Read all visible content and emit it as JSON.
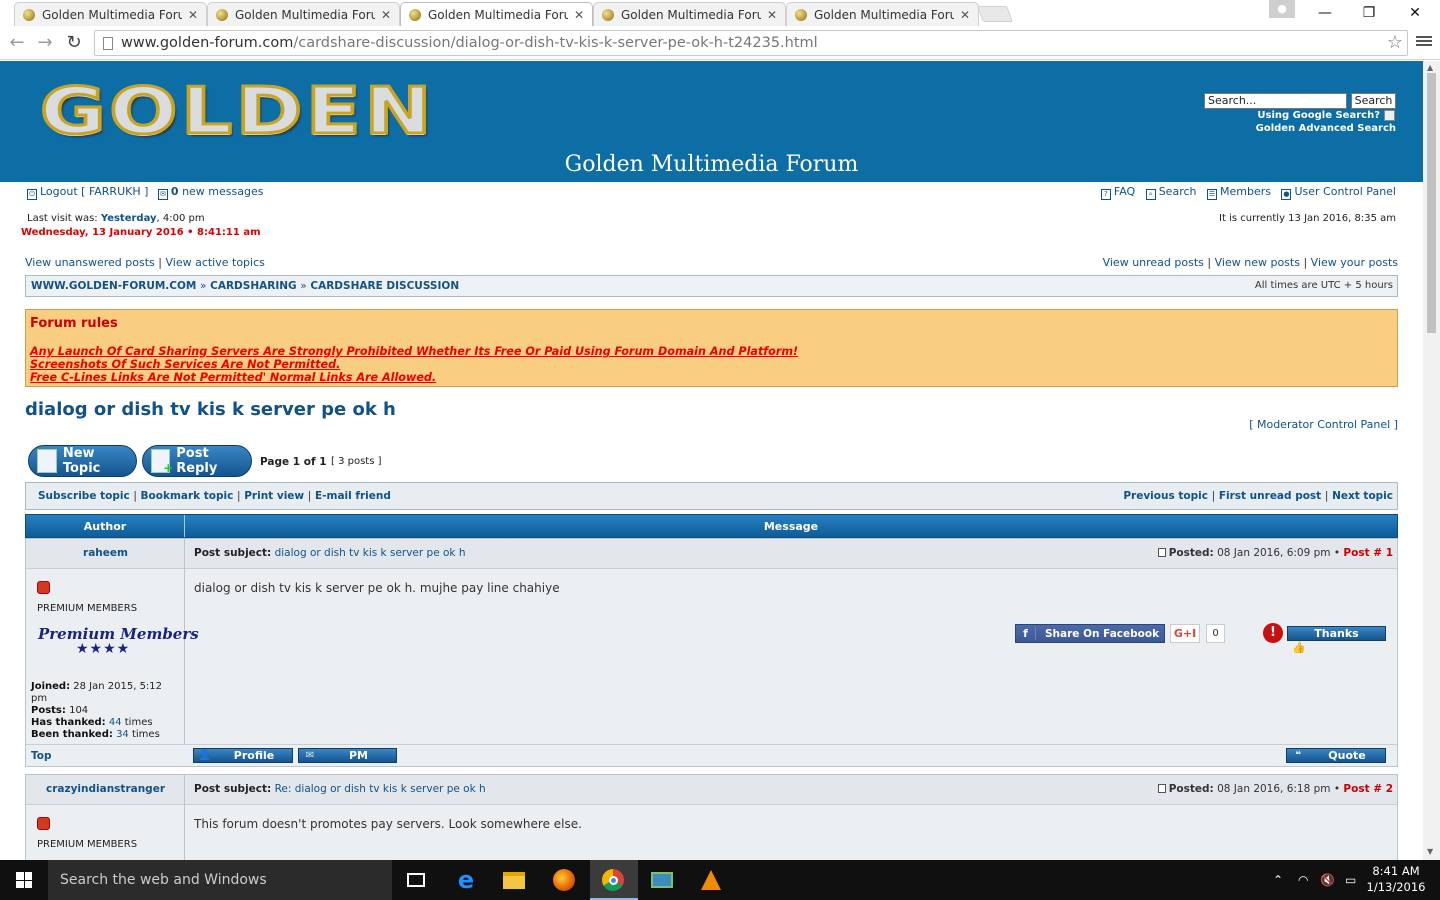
{
  "browser": {
    "tabs": [
      {
        "label": "Golden Multimedia Forum",
        "active": false
      },
      {
        "label": "Golden Multimedia Forum",
        "active": false
      },
      {
        "label": "Golden Multimedia Forum",
        "active": true
      },
      {
        "label": "Golden Multimedia Forum",
        "active": false
      },
      {
        "label": "Golden Multimedia Forum",
        "active": false
      }
    ],
    "url_host": "www.golden-forum.com",
    "url_path": "/cardshare-discussion/dialog-or-dish-tv-kis-k-server-pe-ok-h-t24235.html",
    "icons": [
      "back-icon",
      "forward-icon",
      "reload-icon",
      "bookmark-star-icon",
      "menu-icon",
      "minimize-icon",
      "maximize-icon",
      "close-icon"
    ]
  },
  "header": {
    "logo_text": "GOLDEN",
    "site_title": "Golden Multimedia Forum",
    "search_placeholder": "Search...",
    "search_button": "Search",
    "google_label": "Using Google Search?",
    "advanced_search": "Golden Advanced Search"
  },
  "userbar": {
    "logout": "Logout [ FARRUKH ]",
    "new_messages_count": "0",
    "new_messages_label": "new messages",
    "faq": "FAQ",
    "search": "Search",
    "members": "Members",
    "ucp": "User Control Panel",
    "last_visit_label": "Last visit was:",
    "last_visit_day": "Yesterday",
    "last_visit_time": ", 4:00 pm",
    "current_datetime": "Wednesday, 13 January 2016 • 8:41:11 am",
    "currently": "It is currently 13 Jan 2016, 8:35 am",
    "view_unanswered": "View unanswered posts",
    "view_active": "View active topics",
    "view_unread": "View unread posts",
    "view_new": "View new posts",
    "view_your": "View your posts"
  },
  "breadcrumb": {
    "items": [
      "WWW.GOLDEN-FORUM.COM",
      "CARDSHARING",
      "CARDSHARE DISCUSSION"
    ],
    "timezone": "All times are UTC + 5 hours"
  },
  "rules": {
    "title": "Forum rules",
    "lines": [
      "Any Launch Of Card Sharing Servers Are Strongly Prohibited Whether Its Free Or Paid Using Forum Domain And Platform!",
      "Screenshots Of Such Services Are Not Permitted.",
      "Free C-Lines Links Are Not Permitted' Normal Links Are Allowed."
    ]
  },
  "topic": {
    "title": "dialog or dish tv kis k server pe ok h",
    "mod_panel": "[ Moderator Control Panel ]",
    "new_topic": "New Topic",
    "post_reply": "Post Reply",
    "page_info": "Page 1 of 1",
    "post_count": "[ 3 posts ]",
    "actions_left": [
      "Subscribe topic",
      "Bookmark topic",
      "Print view",
      "E-mail friend"
    ],
    "actions_right": [
      "Previous topic",
      "First unread post",
      "Next topic"
    ],
    "col_author": "Author",
    "col_message": "Message"
  },
  "posts": [
    {
      "author": "raheem",
      "subject_label": "Post subject:",
      "subject": "dialog or dish tv kis k server pe ok h",
      "posted_label": "Posted:",
      "posted": "08 Jan 2016, 6:09 pm",
      "post_num": "Post # 1",
      "rank": "PREMIUM MEMBERS",
      "rank_image_text": "Premium Members",
      "rank_stars": "★★★★",
      "joined_label": "Joined:",
      "joined": "28 Jan 2015, 5:12 pm",
      "posts_label": "Posts:",
      "posts": "104",
      "has_thanked_label": "Has thanked:",
      "has_thanked": "44",
      "been_thanked_label": "Been thanked:",
      "been_thanked": "34",
      "times": "times",
      "body": "dialog or dish tv kis k server pe ok h. mujhe pay line chahiye",
      "share_facebook": "Share On Facebook",
      "gplus": "G+I",
      "gplus_count": "0",
      "thanks": "Thanks",
      "top": "Top",
      "profile": "Profile",
      "pm": "PM",
      "quote": "Quote"
    },
    {
      "author": "crazyindianstranger",
      "subject_label": "Post subject:",
      "subject": "Re: dialog or dish tv kis k server pe ok h",
      "posted_label": "Posted:",
      "posted": "08 Jan 2016, 6:18 pm",
      "post_num": "Post # 2",
      "rank": "PREMIUM MEMBERS",
      "body": "This forum doesn't promotes pay servers. Look somewhere else."
    }
  ],
  "taskbar": {
    "search_placeholder": "Search the web and Windows",
    "time": "8:41 AM",
    "date": "1/13/2016",
    "apps": [
      "task-view-icon",
      "edge-icon",
      "file-explorer-icon",
      "firefox-icon",
      "chrome-icon",
      "network-app-icon",
      "vlc-icon"
    ]
  }
}
